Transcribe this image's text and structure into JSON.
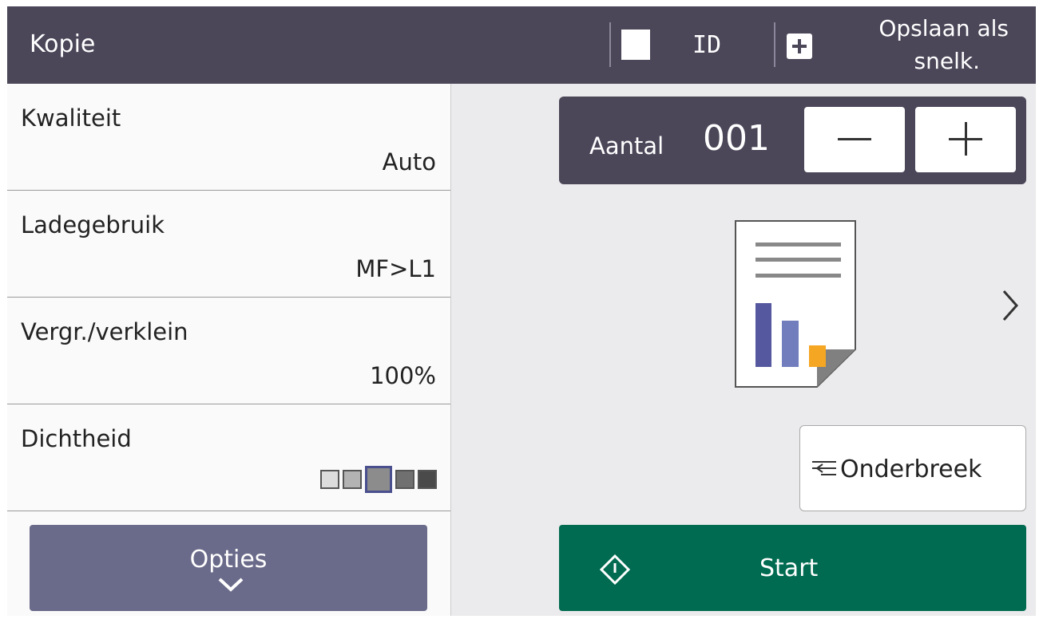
{
  "header": {
    "title": "Kopie",
    "id_label": "ID",
    "save_line1": "Opslaan als",
    "save_line2": "snelk."
  },
  "settings": [
    {
      "label": "Kwaliteit",
      "value": "Auto"
    },
    {
      "label": "Ladegebruik",
      "value": "MF>L1"
    },
    {
      "label": "Vergr./verklein",
      "value": "100%"
    },
    {
      "label": "Dichtheid",
      "value": ""
    }
  ],
  "density": {
    "levels": 5,
    "selected_index": 2,
    "colors": [
      "#dcdcdc",
      "#b3b3b3",
      "#8c8c8c",
      "#707070",
      "#4a4a4a"
    ]
  },
  "options_button": {
    "label": "Opties"
  },
  "copies": {
    "label": "Aantal",
    "value": "001"
  },
  "interrupt_button": {
    "label": "Onderbreek"
  },
  "start_button": {
    "label": "Start"
  },
  "colors": {
    "header_bg": "#4b4658",
    "start_green": "#006b50",
    "options_bg": "#6a6a8a"
  },
  "icons": [
    "checkbox-icon",
    "plus-icon",
    "minus-icon",
    "document-preview-icon",
    "chevron-right-icon",
    "chevron-down-icon",
    "interrupt-icon",
    "start-icon"
  ]
}
